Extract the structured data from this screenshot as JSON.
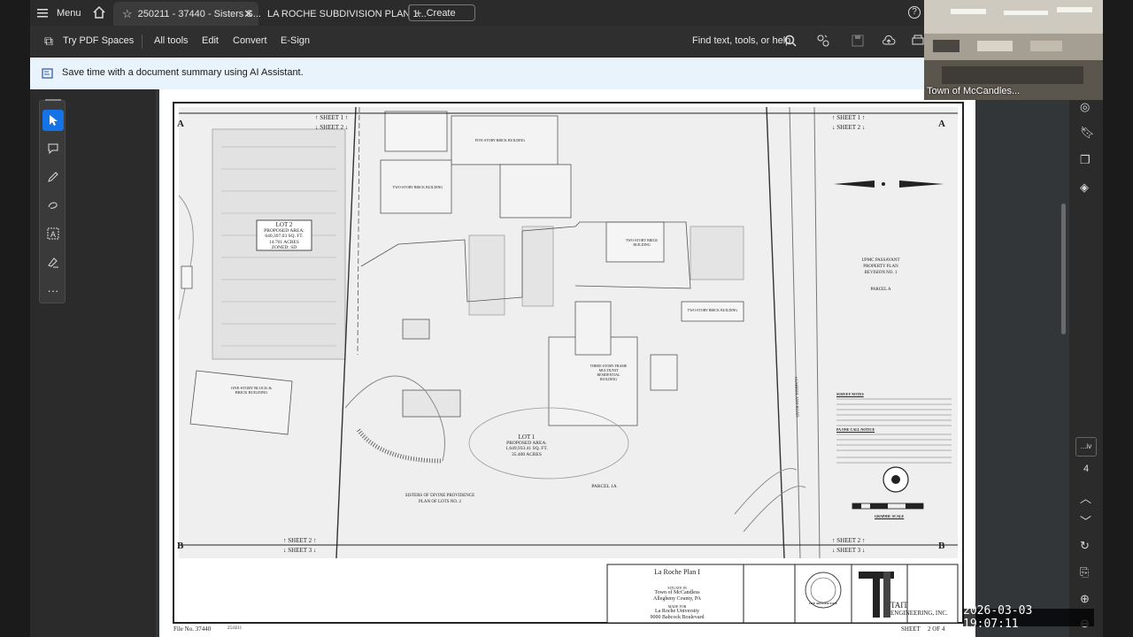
{
  "tabbar": {
    "menu_label": "Menu",
    "tab_active_title": "250211 - 37440 - Sisters S...",
    "tab_second_title": "LA ROCHE SUBDIVISION PLAN 1...",
    "create_label": "Create"
  },
  "toolbar": {
    "try_pdf_spaces": "Try PDF Spaces",
    "all_tools": "All tools",
    "edit": "Edit",
    "convert": "Convert",
    "esign": "E-Sign",
    "search_placeholder": "Find text, tools, or help"
  },
  "banner": {
    "text": "Save time with a document summary using AI Assistant."
  },
  "drawing": {
    "sheet1_up": "↑ SHEET 1 ↑",
    "sheet2_down": "↓ SHEET 2 ↓",
    "sheet2_up": "↑ SHEET 2 ↑",
    "sheet3_down": "↓ SHEET 3 ↓",
    "match_a": "A",
    "match_b": "B",
    "lot2": "LOT 2",
    "lot2_area": "PROPOSED AREA:",
    "lot2_sqft": "640,397.03 SQ. FT.",
    "lot2_acres": "14.701 ACRES",
    "lot2_zoning": "ZONED: SD",
    "lot1": "LOT 1",
    "lot1_area": "PROPOSED AREA:",
    "lot1_sqft": "1,649,933.41 SQ. FT.",
    "lot1_acres": "35.400 ACRES",
    "two_story_bldg": "TWO-STORY BRICK BUILDING",
    "five_story_bldg": "FIVE-STORY BRICK BUILDING",
    "one_story_bldg": "ONE-STORY BLOCK & BRICK BUILDING",
    "three_story_bldg": "THREE-STORY FRAME MULTIUNIT RESIDENTIAL BUILDING",
    "upmc_1": "UPMC PASSAVANT",
    "upmc_2": "PROPERTY PLAN",
    "upmc_3": "REVISION NO. 1",
    "parcel_a": "PARCEL A",
    "parcel_1a": "PARCEL 1A",
    "sisters_1": "SISTERS OF DIVINE PROVIDENCE",
    "sisters_2": "PLAN OF LOTS NO. 2",
    "cumberland": "CUMBERLAND ROAD",
    "survey_notes": "SURVEY NOTES",
    "pa_one_call": "PA ONE CALL NOTICE",
    "graphic_scale": "GRAPHIC SCALE",
    "title_plan": "La Roche Plan I",
    "title_situate": "SITUATE IN",
    "title_town": "Town of McCandless",
    "title_county": "Allegheny County, PA",
    "title_made_for": "MADE FOR",
    "title_client": "La Roche University",
    "title_address": "9000 Babcock Boulevard",
    "tait_1": "TAIT",
    "tait_2": "ENGINEERING, INC.",
    "file_no": "File No. 37440",
    "file_date": "25.0211",
    "sheet_label": "SHEET",
    "sheet_of": "2 OF 4",
    "seal_name": "LEE ARTHUR TAIT"
  },
  "sidebar_right": {
    "page_label": "...iv",
    "page_number": "4"
  },
  "webcam": {
    "caption": "Town of McCandles..."
  },
  "timestamp": "2026-03-03  19:07:11",
  "colors": {
    "accent": "#1473e6",
    "banner_bg": "#e9f3fb",
    "chrome": "#2b2b2b"
  }
}
